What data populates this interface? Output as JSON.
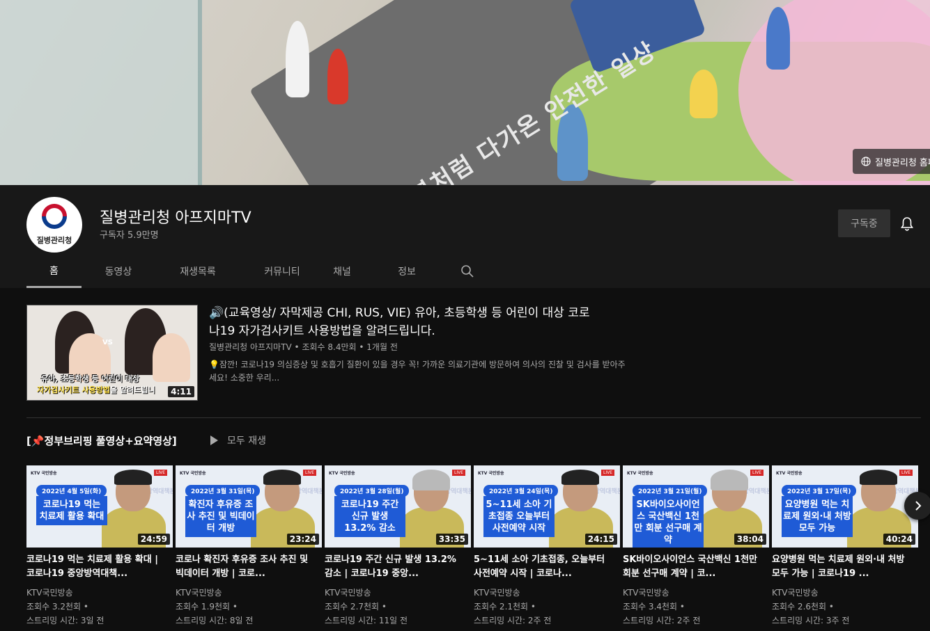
{
  "banner": {
    "road_text": "봄처럼 다가온 안전한 일상",
    "link_label": "질병관리청 홈페"
  },
  "channel": {
    "avatar_text": "질병관리청",
    "name": "질병관리청 아프지마TV",
    "subscribers": "구독자 5.9만명",
    "subscribe_label": "구독중"
  },
  "tabs": [
    {
      "label": "홈",
      "active": true
    },
    {
      "label": "동영상"
    },
    {
      "label": "재생목록"
    },
    {
      "label": "커뮤니티"
    },
    {
      "label": "채널"
    },
    {
      "label": "정보"
    }
  ],
  "featured": {
    "thumb_caption_1": "유아, 초등학생 등 어린이 대상",
    "thumb_caption_2a": "자가검사키트 사용방법",
    "thumb_caption_2b": "을 알려드립니",
    "thumb_vs": "VS",
    "duration": "4:11",
    "title": "🔊(교육영상/ 자막제공 CHI, RUS, VIE) 유아, 초등학생 등 어린이 대상 코로나19 자가검사키트 사용방법을 알려드립니다.",
    "channel": "질병관리청 아프지마TV",
    "views": "조회수 8.4만회",
    "age": "1개월 전",
    "description": "💡잠깐! 코로나19 의심증상 및 호흡기 질환이 있을 경우 꼭! 가까운 의료기관에 방문하여 의사의 진찰 및 검사를 받아주세요! 소중한 우리..."
  },
  "shelf": {
    "title": "[📌정부브리핑 풀영상+요약영상]",
    "play_all": "모두 재생"
  },
  "videos": [
    {
      "thumb_date": "2022년 4월 5일(화)",
      "thumb_text": "코로나19 먹는 치료제 활용 확대",
      "speaker": "dark",
      "duration": "24:59",
      "title": "코로나19 먹는 치료제 활용 확대 | 코로나19 중앙방역대책...",
      "channel": "KTV국민방송",
      "views": "조회수 3.2천회 •",
      "time": "스트리밍 시간: 3일 전"
    },
    {
      "thumb_date": "2022년 3월 31일(목)",
      "thumb_text": "확진자 후유증 조사 추진 및 빅데이터 개방",
      "speaker": "dark",
      "duration": "23:24",
      "title": "코로나 확진자 후유증 조사 추진 및 빅데이터 개방 | 코로...",
      "channel": "KTV국민방송",
      "views": "조회수 1.9천회 •",
      "time": "스트리밍 시간: 8일 전"
    },
    {
      "thumb_date": "2022년 3월 28일(월)",
      "thumb_text": "코로나19 주간 신규 발생 13.2% 감소",
      "speaker": "grey",
      "duration": "33:35",
      "title": "코로나19 주간 신규 발생 13.2% 감소 | 코로나19 중앙...",
      "channel": "KTV국민방송",
      "views": "조회수 2.7천회 •",
      "time": "스트리밍 시간: 11일 전"
    },
    {
      "thumb_date": "2022년 3월 24일(목)",
      "thumb_text": "5~11세 소아 기초접종 오늘부터 사전예약 시작",
      "speaker": "dark",
      "duration": "24:15",
      "title": "5~11세 소아 기초접종, 오늘부터 사전예약 시작 | 코로나...",
      "channel": "KTV국민방송",
      "views": "조회수 2.1천회 •",
      "time": "스트리밍 시간: 2주 전"
    },
    {
      "thumb_date": "2022년 3월 21일(월)",
      "thumb_text": "SK바이오사이언스 국산백신 1천만 회분 선구매 계약",
      "speaker": "grey",
      "duration": "38:04",
      "title": "SK바이오사이언스 국산백신 1천만 회분 선구매 계약 | 코...",
      "channel": "KTV국민방송",
      "views": "조회수 3.4천회 •",
      "time": "스트리밍 시간: 2주 전"
    },
    {
      "thumb_date": "2022년 3월 17일(목)",
      "thumb_text": "요양병원 먹는 치료제 원외·내 처방 모두 가능",
      "speaker": "dark",
      "duration": "40:24",
      "title": "요양병원 먹는 치료제 원외·내 처방 모두 가능 | 코로나19 ...",
      "channel": "KTV국민방송",
      "views": "조회수 2.6천회 •",
      "time": "스트리밍 시간: 3주 전"
    }
  ],
  "thumb_header": "KTV 국민방송",
  "thumb_live": "LIVE",
  "thumb_podium_text": "중앙방역대책본부",
  "colors": {
    "background": "#0f0f0f",
    "header_bg": "#181818",
    "thumb_blue": "#1f5bd6",
    "secondary_text": "#aaaaaa"
  }
}
